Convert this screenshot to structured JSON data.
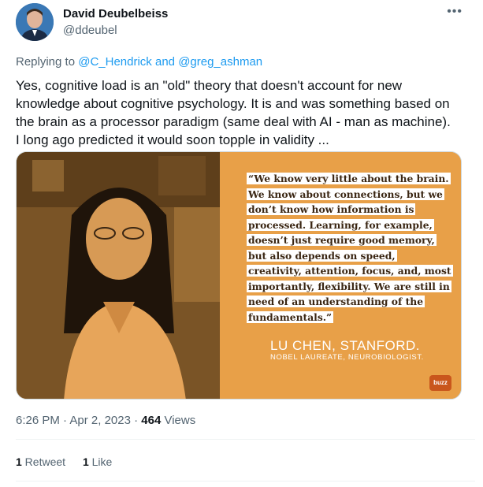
{
  "author": {
    "name": "David Deubelbeiss",
    "handle": "@ddeubel"
  },
  "reply": {
    "prefix": "Replying to ",
    "user1": "@C_Hendrick",
    "joiner": " and ",
    "user2": "@greg_ashman"
  },
  "tweet_text": "Yes, cognitive load is an \"old\" theory that doesn't account for new knowledge about cognitive psychology. It is and was something based on the brain as a processor paradigm (same deal with AI - man as machine).  I long ago predicted it would soon topple in validity ...",
  "media": {
    "quote": "“We know very little about the brain. We know about connections, but we don’t know how information is processed. Learning, for example, doesn’t just require good memory, but also depends on speed, creativity, attention, focus, and, most importantly, flexibility. We are still in need of an understanding of the fundamentals.”",
    "author": "LU CHEN, STANFORD.",
    "author_sub": "NOBEL LAUREATE, NEUROBIOLOGIST.",
    "logo": "buzz"
  },
  "meta": {
    "time": "6:26 PM",
    "dot1": " · ",
    "date": "Apr 2, 2023",
    "dot2": " · ",
    "views_count": "464",
    "views_label": " Views"
  },
  "stats": {
    "retweets_count": "1",
    "retweets_label": " Retweet",
    "likes_count": "1",
    "likes_label": " Like"
  },
  "colors": {
    "link": "#1d9bf0",
    "muted": "#536471",
    "media_bg": "#e8a048"
  }
}
